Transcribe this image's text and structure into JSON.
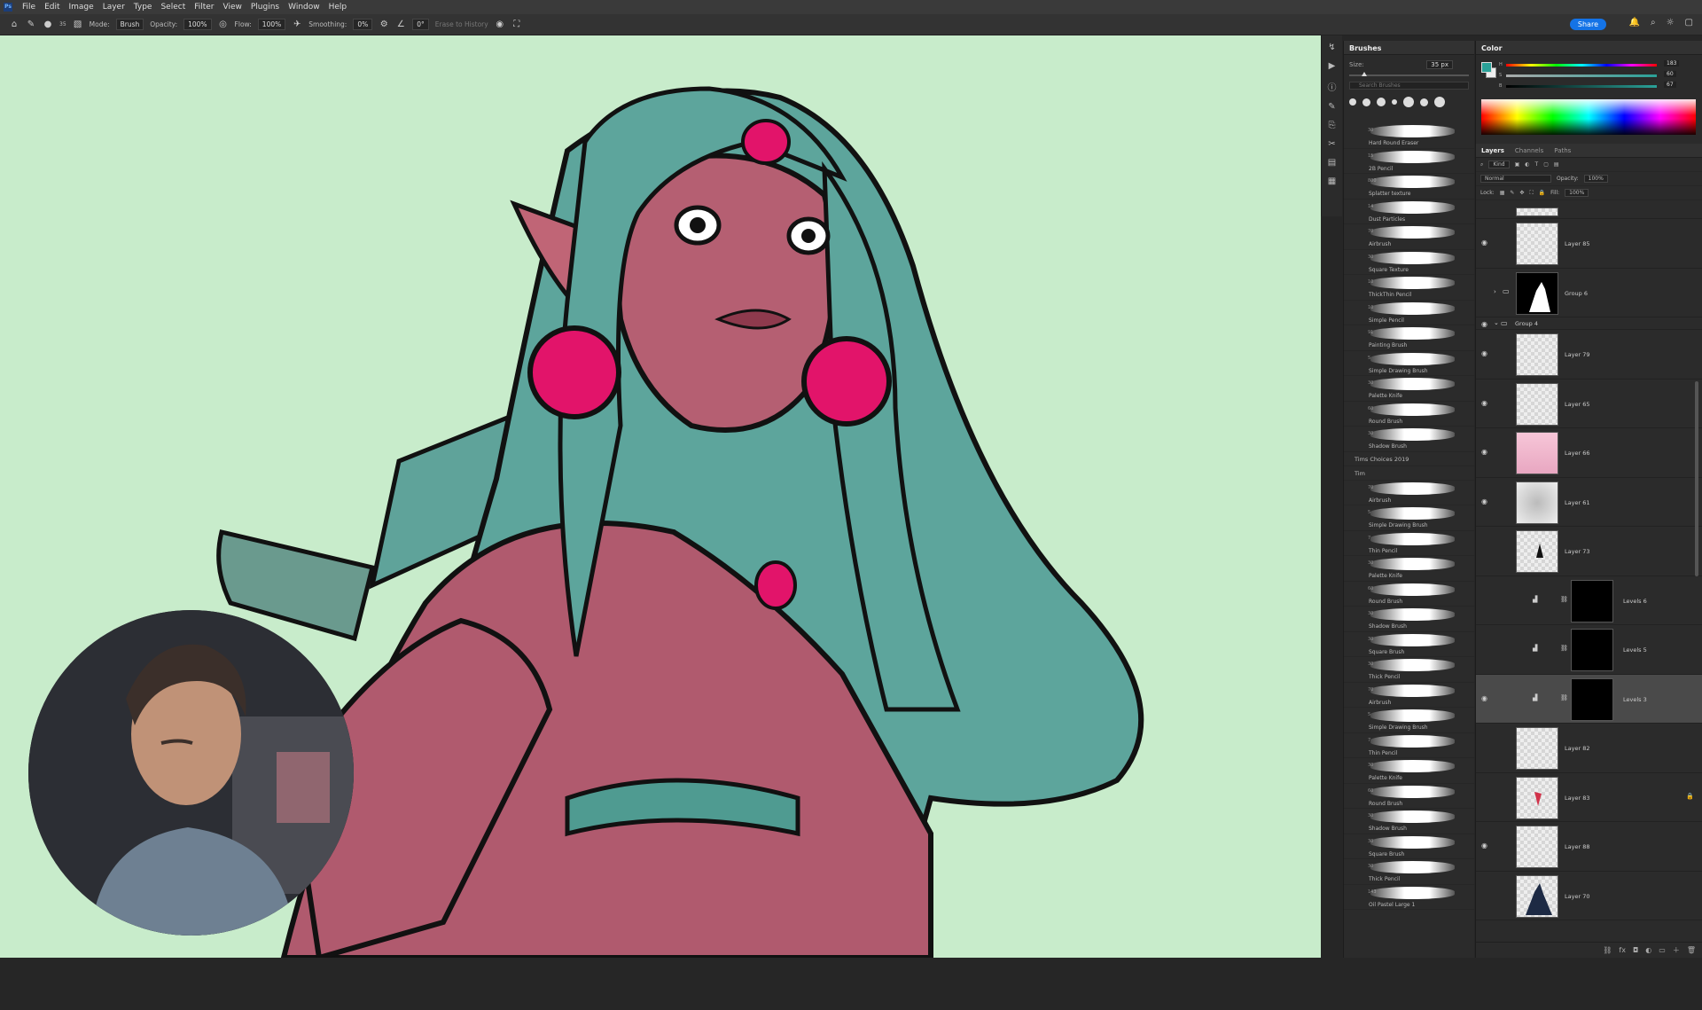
{
  "menu": [
    "File",
    "Edit",
    "Image",
    "Layer",
    "Type",
    "Select",
    "Filter",
    "View",
    "Plugins",
    "Window",
    "Help"
  ],
  "options": {
    "brush_size": "35",
    "mode_label": "Mode:",
    "mode_value": "Brush",
    "opacity_label": "Opacity:",
    "opacity_value": "100%",
    "flow_label": "Flow:",
    "flow_value": "100%",
    "smoothing_label": "Smoothing:",
    "smoothing_value": "0%",
    "angle_value": "0°",
    "erase_label": "Erase to History"
  },
  "share_label": "Share",
  "brushes_panel": {
    "title": "Brushes",
    "size_label": "Size:",
    "size_value": "35 px",
    "search_placeholder": "Search Brushes",
    "preset_sizes": [
      "35",
      "25",
      "30",
      "15",
      "60",
      "20",
      "45"
    ],
    "items": [
      {
        "name": "Hard Round Eraser",
        "size": "30"
      },
      {
        "name": "2B Pencil",
        "size": "15"
      },
      {
        "name": "Splatter texture",
        "size": "800"
      },
      {
        "name": "Dust Particles",
        "size": "14"
      },
      {
        "name": "Airbrush",
        "size": "70"
      },
      {
        "name": "Square Texture",
        "size": "30"
      },
      {
        "name": "ThickThin Pencil",
        "size": "10"
      },
      {
        "name": "Simple Pencil",
        "size": "10"
      },
      {
        "name": "Painting Brush",
        "size": "91"
      },
      {
        "name": "Simple Drawing Brush",
        "size": "5"
      },
      {
        "name": "Palette Knife",
        "size": "30"
      },
      {
        "name": "Round Brush",
        "size": "60"
      },
      {
        "name": "Shadow Brush",
        "size": "30"
      }
    ],
    "folder1": "Tims Choices 2019",
    "folder2": "Tim",
    "items2": [
      {
        "name": "Airbrush",
        "size": "70"
      },
      {
        "name": "Simple Drawing Brush",
        "size": "5"
      },
      {
        "name": "Thin Pencil",
        "size": "7"
      },
      {
        "name": "Palette Knife",
        "size": "30"
      },
      {
        "name": "Round Brush",
        "size": "60"
      },
      {
        "name": "Shadow Brush",
        "size": "30"
      },
      {
        "name": "Square Brush",
        "size": "30"
      },
      {
        "name": "Thick Pencil",
        "size": "30"
      },
      {
        "name": "Airbrush",
        "size": "70"
      },
      {
        "name": "Simple Drawing Brush",
        "size": "5"
      },
      {
        "name": "Thin Pencil",
        "size": "7"
      },
      {
        "name": "Palette Knife",
        "size": "30"
      },
      {
        "name": "Round Brush",
        "size": "60"
      },
      {
        "name": "Shadow Brush",
        "size": "30"
      },
      {
        "name": "Square Brush",
        "size": "30"
      },
      {
        "name": "Thick Pencil",
        "size": "30"
      },
      {
        "name": "Oil Pastel Large 1",
        "size": "143"
      }
    ]
  },
  "color_panel": {
    "title": "Color",
    "h_label": "H",
    "s_label": "S",
    "b_label": "B",
    "h_value": "183",
    "s_value": "60",
    "b_value": "67",
    "fg_color": "#2aa198"
  },
  "layers_panel": {
    "tabs": [
      "Layers",
      "Channels",
      "Paths"
    ],
    "kind_label": "Kind",
    "blend_mode": "Normal",
    "opacity_label": "Opacity:",
    "opacity_value": "100%",
    "lock_label": "Lock:",
    "fill_label": "Fill:",
    "fill_value": "100%",
    "group6": "Group 6",
    "group4": "Group 4",
    "layers": [
      "Layer 85",
      "Layer 79",
      "Layer 65",
      "Layer 66",
      "Layer 61",
      "Layer 73",
      "Levels 6",
      "Levels 5",
      "Levels 3",
      "Layer 82",
      "Layer 83",
      "Layer 88",
      "Layer 70"
    ]
  }
}
